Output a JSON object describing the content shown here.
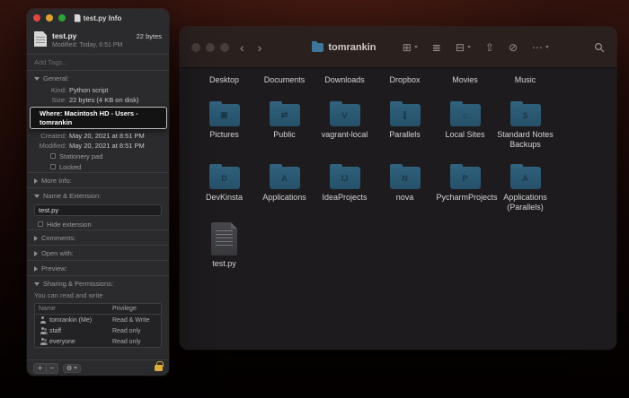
{
  "info_window": {
    "title": "test.py Info",
    "file_name": "test.py",
    "file_size": "22 bytes",
    "modified_short": "Modified: Today, 6:51 PM",
    "add_tags": "Add Tags...",
    "general": {
      "header": "General:",
      "kind_label": "Kind:",
      "kind_value": "Python script",
      "size_label": "Size:",
      "size_value": "22 bytes (4 KB on disk)",
      "where_tooltip": "Where: Macintosh HD - Users - tomrankin",
      "created_label": "Created:",
      "created_value": "May 20, 2021 at 8:51 PM",
      "modified_label": "Modified:",
      "modified_value": "May 20, 2021 at 8:51 PM",
      "stationery_label": "Stationery pad",
      "locked_label": "Locked"
    },
    "more_info_header": "More Info:",
    "name_ext_header": "Name & Extension:",
    "name_field": "test.py",
    "hide_extension_label": "Hide extension",
    "comments_header": "Comments:",
    "open_with_header": "Open with:",
    "preview_header": "Preview:",
    "sharing": {
      "header": "Sharing & Permissions:",
      "subtext": "You can read and write",
      "col_name": "Name",
      "col_privilege": "Privilege",
      "rows": [
        {
          "name": "tomrankin (Me)",
          "privilege": "Read & Write"
        },
        {
          "name": "staff",
          "privilege": "Read only"
        },
        {
          "name": "everyone",
          "privilege": "Read only"
        }
      ]
    },
    "add_label": "+",
    "remove_label": "−",
    "action_glyph": "⚙"
  },
  "finder": {
    "title": "tomrankin",
    "back": "‹",
    "forward": "›",
    "toolbar_icons": [
      {
        "name": "icon-view",
        "glyph": "⊞"
      },
      {
        "name": "list-view",
        "glyph": "≣"
      },
      {
        "name": "group-by",
        "glyph": "⊟"
      },
      {
        "name": "share",
        "glyph": "⇧"
      },
      {
        "name": "tags",
        "glyph": "⊘"
      },
      {
        "name": "more-actions",
        "glyph": "⋯"
      }
    ],
    "items": [
      {
        "name": "Desktop",
        "glyph": ""
      },
      {
        "name": "Documents",
        "glyph": ""
      },
      {
        "name": "Downloads",
        "glyph": ""
      },
      {
        "name": "Dropbox",
        "glyph": ""
      },
      {
        "name": "Movies",
        "glyph": ""
      },
      {
        "name": "Music",
        "glyph": ""
      },
      {
        "name": "Pictures",
        "glyph": "▣"
      },
      {
        "name": "Public",
        "glyph": "⇄"
      },
      {
        "name": "vagrant-local",
        "glyph": "V"
      },
      {
        "name": "Parallels",
        "glyph": "∥"
      },
      {
        "name": "Local Sites",
        "glyph": "⌂"
      },
      {
        "name": "Standard Notes Backups",
        "glyph": "S"
      },
      {
        "name": "DevKinsta",
        "glyph": "D"
      },
      {
        "name": "Applications",
        "glyph": "A"
      },
      {
        "name": "IdeaProjects",
        "glyph": "IJ"
      },
      {
        "name": "nova",
        "glyph": "N"
      },
      {
        "name": "PycharmProjects",
        "glyph": "P"
      },
      {
        "name": "Applications (Parallels)",
        "glyph": "A"
      },
      {
        "name": "test.py",
        "glyph": ""
      }
    ]
  }
}
